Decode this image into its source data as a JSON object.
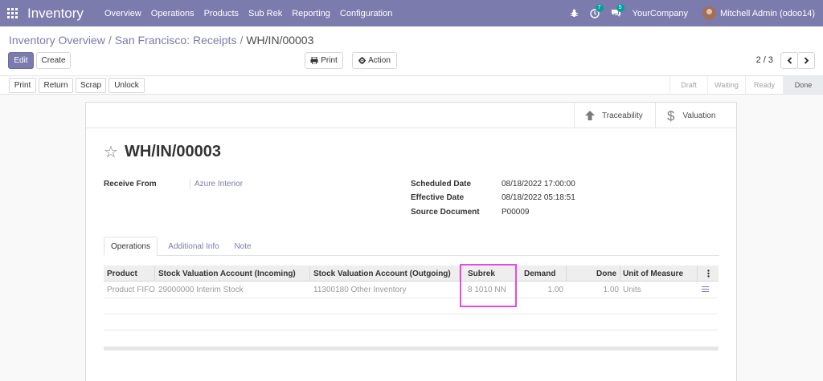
{
  "navbar": {
    "app_name": "Inventory",
    "menu": [
      "Overview",
      "Operations",
      "Products",
      "Sub Rek",
      "Reporting",
      "Configuration"
    ],
    "activity_count": "7",
    "message_count": "5",
    "company": "YourCompany",
    "user": "Mitchell Admin (odoo14)"
  },
  "breadcrumb": {
    "item1": "Inventory Overview",
    "item2": "San Francisco: Receipts",
    "current": "WH/IN/00003",
    "separator": "/"
  },
  "toolbar": {
    "edit_label": "Edit",
    "create_label": "Create",
    "print_label": "Print",
    "action_label": "Action",
    "pager": "2 / 3"
  },
  "statusbar": {
    "buttons": [
      "Print",
      "Return",
      "Scrap",
      "Unlock"
    ],
    "stages": [
      "Draft",
      "Waiting",
      "Ready",
      "Done"
    ],
    "active_stage": "Done"
  },
  "smart_buttons": {
    "traceability": "Traceability",
    "valuation": "Valuation"
  },
  "record": {
    "name": "WH/IN/00003",
    "receive_from_label": "Receive From",
    "receive_from": "Azure Interior",
    "scheduled_date_label": "Scheduled Date",
    "scheduled_date": "08/18/2022 17:00:00",
    "effective_date_label": "Effective Date",
    "effective_date": "08/18/2022 05:18:51",
    "source_document_label": "Source Document",
    "source_document": "P00009"
  },
  "tabs": [
    "Operations",
    "Additional Info",
    "Note"
  ],
  "table": {
    "headers": [
      "Product",
      "Stock Valuation Account (Incoming)",
      "Stock Valuation Account (Outgoing)",
      "Subrek",
      "Demand",
      "Done",
      "Unit of Measure"
    ],
    "rows": [
      {
        "product": "Product FIFO",
        "incoming": "29000000 Interim Stock",
        "outgoing": "11300180 Other Inventory",
        "subrek": "8 1010 NN",
        "demand": "1.00",
        "done": "1.00",
        "uom": "Units"
      }
    ]
  },
  "colors": {
    "brand": "#7c7bad",
    "highlight": "#e34ce3"
  }
}
